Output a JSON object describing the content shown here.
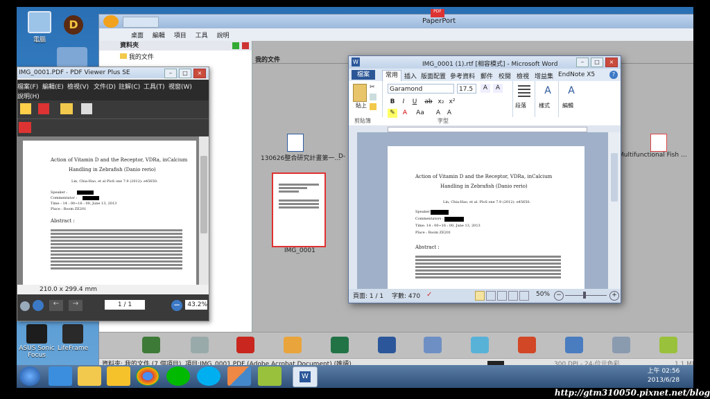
{
  "desktop": {
    "icons": [
      {
        "label": "電腦"
      },
      {
        "label": "ASUS Sonic Focus"
      },
      {
        "label": "LifeFrame"
      }
    ]
  },
  "paperport": {
    "title": "PaperPort",
    "menu": [
      "桌面",
      "編輯",
      "項目",
      "工具",
      "說明"
    ],
    "folder_pane_title": "資料夾",
    "folder_item": "我的文件",
    "docs_title": "我的文件",
    "thumbs": [
      {
        "label": "130626整合研究計畫第一…"
      },
      {
        "label": "D-"
      },
      {
        "label": "IMG_0001"
      },
      {
        "label": "Multifunctional Fish …"
      }
    ],
    "status": "資料夾: 我的文件 (7 個項目), 項目:IMG_0001.PDF (Adobe Acrobat Document) (唯讀).",
    "status_right": "300 DPI - 24-位元色彩",
    "status_size": "1.1 Mbytes"
  },
  "pdf_viewer": {
    "title": "IMG_0001.PDF - PDF Viewer Plus SE",
    "menu": [
      "檔案(F)",
      "編輯(E)",
      "檢視(V)",
      "文件(D)",
      "註解(C)",
      "工具(T)",
      "視窗(W)"
    ],
    "menu2": "說明(H)",
    "doc_title": "Action of Vitamin D and the Receptor, VDRa, inCalcium",
    "doc_title2": "Handling in Zebrafish (Danio rerio)",
    "doc_authors": "Lin, Chia-Hao, et al PloS one 7.9 (2012): e45650.",
    "speaker": "Speaker :",
    "commentator": "Commentator :",
    "time": "Time : 14 : 00~16 : 00, June 13, 2013",
    "place": "Place : Room ZE201",
    "abstract": "Abstract :",
    "page_size": "210.0 x 299.4 mm",
    "page": "1 / 1",
    "zoom": "43.2%"
  },
  "word": {
    "title": "IMG_0001 (1).rtf [相容模式] - Microsoft Word",
    "tabs": [
      "檔案",
      "常用",
      "插入",
      "版面配置",
      "參考資料",
      "郵件",
      "校閱",
      "檢視",
      "增益集",
      "EndNote X5"
    ],
    "font": "Garamond",
    "size": "17.5",
    "groups": [
      "剪貼簿",
      "字型",
      "段落",
      "樣式",
      "編輯"
    ],
    "paste": "貼上",
    "para": "段落",
    "styles": "樣式",
    "editing": "編輯",
    "doc_title": "Action of Vitamin D and the Receptor, VDRa, inCalcium",
    "doc_title2": "Handling in Zebrafish (Danio rerio)",
    "doc_authors": "Lin, Chia-Hao, et al. PloS one 7.9 (2012): e45650.",
    "speaker": "Speaker :",
    "commentator": "Commentators :",
    "time": "Time: 14 : 00~16 : 00, June 13, 2013",
    "place": "Place : Room ZE201",
    "abstract": "Abstract :",
    "status_page": "頁面: 1 / 1",
    "status_words": "字數: 470",
    "zoom": "50%"
  },
  "taskbar": {
    "time": "上午 02:56",
    "date": "2013/6/28"
  },
  "footer": "http://gtm310050.pixnet.net/blog"
}
